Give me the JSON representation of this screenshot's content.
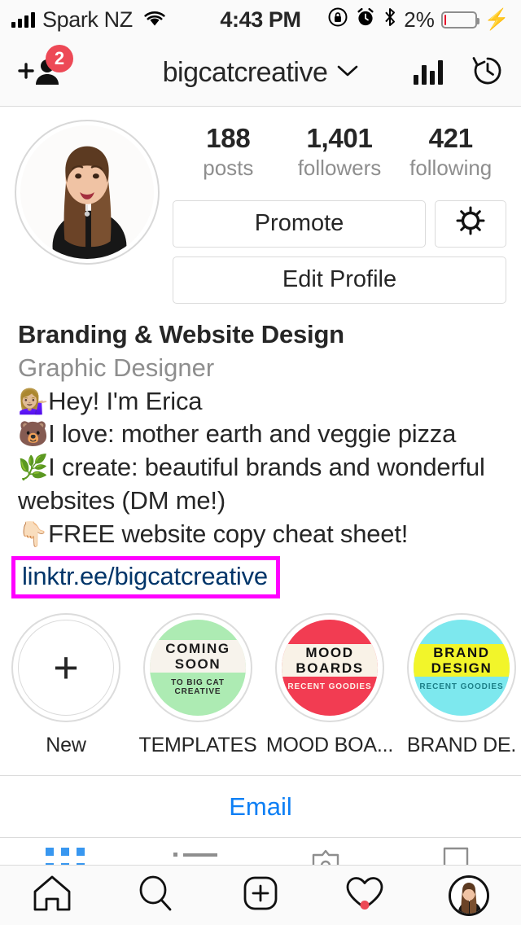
{
  "status_bar": {
    "carrier": "Spark NZ",
    "time": "4:43 PM",
    "battery_percent": "2%",
    "icons": [
      "signal-bars-icon",
      "wifi-icon",
      "rotation-lock-icon",
      "alarm-icon",
      "bluetooth-icon",
      "battery-icon",
      "charging-bolt-icon"
    ]
  },
  "nav_bar": {
    "username": "bigcatcreative",
    "add_person_badge": "2",
    "icons": [
      "add-person-icon",
      "chevron-down-icon",
      "insights-bar-chart-icon",
      "archive-clock-icon"
    ]
  },
  "profile": {
    "stats": [
      {
        "value": "188",
        "label": "posts"
      },
      {
        "value": "1,401",
        "label": "followers"
      },
      {
        "value": "421",
        "label": "following"
      }
    ],
    "buttons": {
      "promote": "Promote",
      "settings_icon": "gear-icon",
      "edit_profile": "Edit Profile"
    },
    "name": "Branding & Website Design",
    "category": "Graphic Designer",
    "bio_lines": [
      {
        "emoji": "💁🏼‍♀️",
        "text": "Hey! I'm Erica"
      },
      {
        "emoji": "🐻",
        "text": "I love: mother earth and veggie pizza"
      },
      {
        "emoji": "🌿",
        "text": "I create: beautiful brands and wonderful websites (DM me!)"
      },
      {
        "emoji": "👇🏻",
        "text": "FREE website copy cheat sheet!"
      }
    ],
    "link": "linktr.ee/bigcatcreative",
    "link_highlight_color": "#FF00FF",
    "link_color": "#003569"
  },
  "highlights": [
    {
      "label": "New",
      "type": "new",
      "glyph": "+"
    },
    {
      "label": "TEMPLATES",
      "type": "cover",
      "bg": "#ADEBB3",
      "title": "COMING SOON",
      "subtitle": "TO BIG CAT CREATIVE"
    },
    {
      "label": "MOOD BOA...",
      "type": "cover",
      "bg": "#F23C52",
      "title": "MOOD BOARDS",
      "subtitle": "RECENT GOODIES"
    },
    {
      "label": "BRAND DE.",
      "type": "cover",
      "bg": "#7DE8EE",
      "title": "BRAND DESIGN",
      "subtitle": "RECENT GOODIES"
    }
  ],
  "email_button": {
    "label": "Email",
    "color": "#0D7FF5"
  },
  "tabs": [
    {
      "name": "grid",
      "icon": "grid-icon",
      "active": true
    },
    {
      "name": "list",
      "icon": "list-icon",
      "active": false
    },
    {
      "name": "tagged",
      "icon": "tagged-person-icon",
      "active": false
    },
    {
      "name": "saved",
      "icon": "bookmark-icon",
      "active": false
    }
  ],
  "tab_bar": [
    {
      "name": "home",
      "icon": "home-icon"
    },
    {
      "name": "search",
      "icon": "search-icon"
    },
    {
      "name": "new-post",
      "icon": "plus-square-icon"
    },
    {
      "name": "activity",
      "icon": "heart-icon",
      "has_notification": true
    },
    {
      "name": "profile",
      "icon": "profile-avatar-icon"
    }
  ]
}
